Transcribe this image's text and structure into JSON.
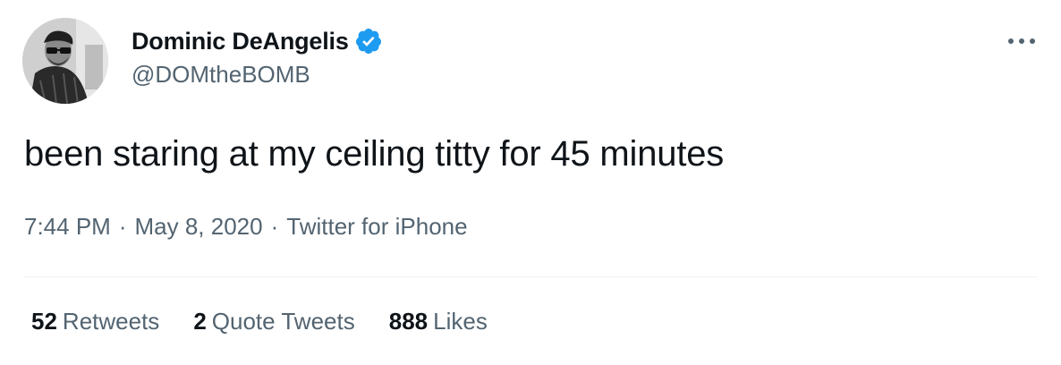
{
  "author": {
    "display_name": "Dominic DeAngelis",
    "handle": "@DOMtheBOMB",
    "verified": true,
    "avatar_icon": "profile-photo"
  },
  "tweet": {
    "text": "been staring at my ceiling titty for 45 minutes",
    "time": "7:44 PM",
    "date": "May 8, 2020",
    "source": "Twitter for iPhone",
    "separator": "·"
  },
  "stats": {
    "retweets_count": "52",
    "retweets_label": "Retweets",
    "quotes_count": "2",
    "quotes_label": "Quote Tweets",
    "likes_count": "888",
    "likes_label": "Likes"
  },
  "colors": {
    "primary_text": "#0f1419",
    "secondary_text": "#536471",
    "verified_blue": "#1d9bf0",
    "divider": "#eff3f4"
  }
}
